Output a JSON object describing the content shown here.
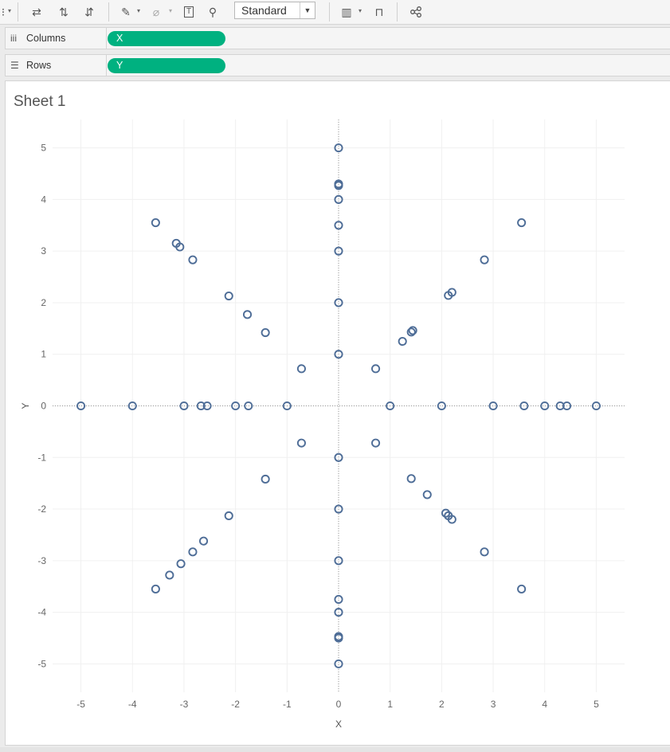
{
  "toolbar": {
    "fit_value": "Standard",
    "icons": [
      "swap-rows-cols-icon",
      "sort-ascending-icon",
      "sort-descending-icon",
      "highlight-icon",
      "group-members-icon",
      "label-marks-icon",
      "pin-icon",
      "show-me-icon",
      "presentation-icon",
      "share-icon"
    ]
  },
  "shelves": {
    "columns": {
      "label": "Columns",
      "pill": "X"
    },
    "rows": {
      "label": "Rows",
      "pill": "Y"
    }
  },
  "colors": {
    "pill": "#00b180",
    "mark": "#4e6d97"
  },
  "sheet": {
    "title": "Sheet 1"
  },
  "chart_data": {
    "type": "scatter",
    "title": "Sheet 1",
    "xlabel": "X",
    "ylabel": "Y",
    "xlim": [
      -5.55,
      5.55
    ],
    "ylim": [
      -5.55,
      5.55
    ],
    "xticks": [
      -5,
      -4,
      -3,
      -2,
      -1,
      0,
      1,
      2,
      3,
      4,
      5
    ],
    "yticks": [
      5,
      4,
      3,
      2,
      1,
      0,
      -1,
      -2,
      -3,
      -4,
      -5
    ],
    "grid": true,
    "marker": "hollow-circle",
    "points": [
      [
        0,
        5
      ],
      [
        0,
        4.3
      ],
      [
        0,
        4.27
      ],
      [
        0,
        4
      ],
      [
        0,
        3.5
      ],
      [
        0,
        3
      ],
      [
        0,
        2
      ],
      [
        0,
        1
      ],
      [
        0,
        -1
      ],
      [
        0,
        -2
      ],
      [
        0,
        -3
      ],
      [
        0,
        -3.75
      ],
      [
        0,
        -4
      ],
      [
        0,
        -4.47
      ],
      [
        0,
        -4.5
      ],
      [
        0,
        -5
      ],
      [
        -5,
        0
      ],
      [
        -4,
        0
      ],
      [
        -3,
        0
      ],
      [
        -2.67,
        0
      ],
      [
        -2.55,
        0
      ],
      [
        -2,
        0
      ],
      [
        -1.75,
        0
      ],
      [
        -1,
        0
      ],
      [
        1,
        0
      ],
      [
        2,
        0
      ],
      [
        3,
        0
      ],
      [
        3.6,
        0
      ],
      [
        4,
        0
      ],
      [
        4.3,
        0
      ],
      [
        4.43,
        0
      ],
      [
        5,
        0
      ],
      [
        -3.55,
        3.55
      ],
      [
        -3.15,
        3.15
      ],
      [
        -3.08,
        3.08
      ],
      [
        -2.83,
        2.83
      ],
      [
        -2.13,
        2.13
      ],
      [
        -1.77,
        1.77
      ],
      [
        -1.42,
        1.42
      ],
      [
        -0.72,
        0.72
      ],
      [
        0.72,
        0.72
      ],
      [
        1.24,
        1.25
      ],
      [
        1.41,
        1.43
      ],
      [
        1.44,
        1.46
      ],
      [
        2.13,
        2.14
      ],
      [
        2.2,
        2.2
      ],
      [
        2.83,
        2.83
      ],
      [
        3.55,
        3.55
      ],
      [
        -0.72,
        -0.72
      ],
      [
        -1.42,
        -1.42
      ],
      [
        -2.13,
        -2.13
      ],
      [
        -2.62,
        -2.62
      ],
      [
        -2.83,
        -2.83
      ],
      [
        -3.06,
        -3.06
      ],
      [
        -3.28,
        -3.28
      ],
      [
        -3.55,
        -3.55
      ],
      [
        0.72,
        -0.72
      ],
      [
        1.41,
        -1.41
      ],
      [
        1.72,
        -1.72
      ],
      [
        2.08,
        -2.08
      ],
      [
        2.13,
        -2.13
      ],
      [
        2.2,
        -2.2
      ],
      [
        2.83,
        -2.83
      ],
      [
        3.55,
        -3.55
      ]
    ]
  }
}
